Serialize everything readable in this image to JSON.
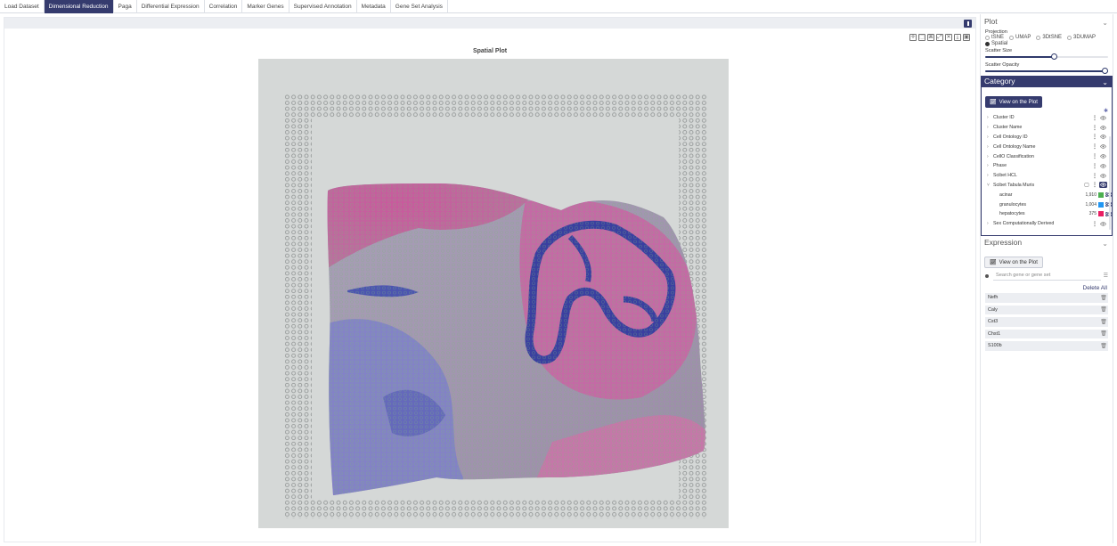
{
  "tabs": [
    {
      "label": "Load Dataset"
    },
    {
      "label": "Dimensional Reduction",
      "active": true
    },
    {
      "label": "Paga"
    },
    {
      "label": "Differential Expression"
    },
    {
      "label": "Correlation"
    },
    {
      "label": "Marker Genes"
    },
    {
      "label": "Supervised Annotation"
    },
    {
      "label": "Metadata"
    },
    {
      "label": "Gene Set Analysis"
    }
  ],
  "plot": {
    "title": "Spatial Plot",
    "toolbar_icons": [
      "pan-icon",
      "box-select-icon",
      "lasso-select-icon",
      "autoscale-icon",
      "reset-axes-icon",
      "download-icon",
      "save-icon"
    ]
  },
  "sidebar": {
    "plot_section": {
      "title": "Plot",
      "projection_label": "Projection",
      "projections": [
        {
          "label": "tSNE",
          "selected": false
        },
        {
          "label": "UMAP",
          "selected": false
        },
        {
          "label": "3DtSNE",
          "selected": false
        },
        {
          "label": "3DUMAP",
          "selected": false
        },
        {
          "label": "Spatial",
          "selected": true
        }
      ],
      "scatter_size_label": "Scatter Size",
      "scatter_size_fraction": 0.56,
      "scatter_opacity_label": "Scatter Opacity",
      "scatter_opacity_fraction": 1.0
    },
    "category_section": {
      "title": "Category",
      "view_button": "View on the Plot",
      "items": [
        {
          "label": "Cluster ID",
          "expanded": false
        },
        {
          "label": "Cluster Name",
          "expanded": false
        },
        {
          "label": "Cell Ontology ID",
          "expanded": false
        },
        {
          "label": "Cell Ontology Name",
          "expanded": false
        },
        {
          "label": "CellO Classification",
          "expanded": false
        },
        {
          "label": "Phase",
          "expanded": false
        },
        {
          "label": "Scibet HCL",
          "expanded": false
        },
        {
          "label": "Scibet Tabula Muris",
          "expanded": true,
          "children": [
            {
              "label": "acinar",
              "count": "1,910",
              "color": "#4caf50"
            },
            {
              "label": "granulocytes",
              "count": "1,004",
              "color": "#2196f3"
            },
            {
              "label": "hepatocytes",
              "count": "375",
              "color": "#e91e63"
            }
          ]
        },
        {
          "label": "Sex Computationally Derived",
          "expanded": false
        }
      ]
    },
    "expression_section": {
      "title": "Expression",
      "view_button": "View on the Plot",
      "search_placeholder": "Search gene or gene set",
      "delete_all": "Delete All",
      "genes": [
        "Nefh",
        "Caly",
        "Cst3",
        "Chst1",
        "S100b"
      ]
    }
  },
  "colors": {
    "accent": "#353b6e",
    "tissue_pink": "#c06aa0",
    "tissue_blue": "#3d45a0",
    "background_slide": "#d3d6d6"
  }
}
